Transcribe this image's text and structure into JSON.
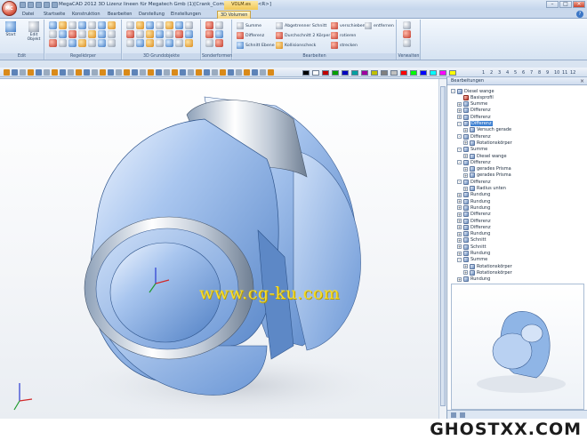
{
  "app": {
    "title": "MegaCAD 2012 3D  Lizenz lineen für Megatech Gmb (1)[Crank_Comsoce-Flan.PRT<R>]",
    "context_tab": "VOLM.es"
  },
  "window_controls": {
    "minimize": "–",
    "maximize": "□",
    "close": "×"
  },
  "tabs": [
    "Datei",
    "Startseite",
    "Konstruktion",
    "Bearbeiten",
    "Darstellung",
    "Einstellungen",
    "3D Volumen"
  ],
  "active_tab": "3D Volumen",
  "ribbon": {
    "groups": {
      "edit": "Edit",
      "regelkoerper": "Regelkörper",
      "grundobjekte": "3D Grundobjekte",
      "sonderformen": "Sonderformen",
      "bearbeiten": "Bearbeiten",
      "verwalten": "Verwalten"
    },
    "start_label": "Start",
    "edit_objekt_label": "Edit Objekt",
    "bool_ops": [
      "Summe",
      "Differenz",
      "Schnitt Ebene"
    ],
    "cut_ops": [
      "Abgetrenner Schnitt",
      "Durchschnitt 2 Körper",
      "Kollisionscheck"
    ],
    "move_ops": [
      "verschieben",
      "rotieren",
      "strecken"
    ],
    "remove_op": "entfernen"
  },
  "toolbar": {
    "colors": [
      "#000000",
      "#ffffff",
      "#c00000",
      "#00a000",
      "#0000c0",
      "#00a0a0",
      "#a000a0",
      "#c0c000",
      "#808080",
      "#c0c0c0",
      "#ff0000",
      "#00ff00",
      "#0000ff",
      "#00ffff",
      "#ff00ff",
      "#ffff00"
    ],
    "layer_numbers": [
      "1",
      "2",
      "3",
      "4",
      "5",
      "6",
      "7",
      "8",
      "9",
      "10",
      "11",
      "12"
    ]
  },
  "viewport": {
    "watermark": "www.cg-ku.com",
    "part_color": "#8fb5e6"
  },
  "panel": {
    "title": "Bearbeitungen",
    "close": "×",
    "tree": [
      {
        "label": "Diesel wange",
        "level": 0,
        "exp": "-",
        "red": false
      },
      {
        "label": "Basisprofil",
        "level": 1,
        "exp": "",
        "red": true
      },
      {
        "label": "Summe",
        "level": 1,
        "exp": "+",
        "red": false
      },
      {
        "label": "Differenz",
        "level": 1,
        "exp": "+",
        "red": false
      },
      {
        "label": "Differenz",
        "level": 1,
        "exp": "+",
        "red": false
      },
      {
        "label": "Differenz",
        "level": 1,
        "exp": "-",
        "red": false,
        "selected": true
      },
      {
        "label": "Versuch gerade",
        "level": 2,
        "exp": "+",
        "red": false
      },
      {
        "label": "Differenz",
        "level": 1,
        "exp": "-",
        "red": false
      },
      {
        "label": "Rotationskörper",
        "level": 2,
        "exp": "+",
        "red": false
      },
      {
        "label": "Summe",
        "level": 1,
        "exp": "-",
        "red": false
      },
      {
        "label": "Diesel wange",
        "level": 2,
        "exp": "+",
        "red": false
      },
      {
        "label": "Differenz",
        "level": 1,
        "exp": "-",
        "red": false
      },
      {
        "label": "gerades Prisma",
        "level": 2,
        "exp": "+",
        "red": false
      },
      {
        "label": "gerades Prisma",
        "level": 2,
        "exp": "+",
        "red": false
      },
      {
        "label": "Differenz",
        "level": 1,
        "exp": "-",
        "red": false
      },
      {
        "label": "Radius unten",
        "level": 2,
        "exp": "+",
        "red": false
      },
      {
        "label": "Rundung",
        "level": 1,
        "exp": "+",
        "red": false
      },
      {
        "label": "Rundung",
        "level": 1,
        "exp": "+",
        "red": false
      },
      {
        "label": "Rundung",
        "level": 1,
        "exp": "+",
        "red": false
      },
      {
        "label": "Differenz",
        "level": 1,
        "exp": "+",
        "red": false
      },
      {
        "label": "Differenz",
        "level": 1,
        "exp": "+",
        "red": false
      },
      {
        "label": "Differenz",
        "level": 1,
        "exp": "+",
        "red": false
      },
      {
        "label": "Rundung",
        "level": 1,
        "exp": "+",
        "red": false
      },
      {
        "label": "Schnitt",
        "level": 1,
        "exp": "+",
        "red": false
      },
      {
        "label": "Schnitt",
        "level": 1,
        "exp": "+",
        "red": false
      },
      {
        "label": "Rundung",
        "level": 1,
        "exp": "+",
        "red": false
      },
      {
        "label": "Summe",
        "level": 1,
        "exp": "-",
        "red": false
      },
      {
        "label": "Rotationskörper",
        "level": 2,
        "exp": "+",
        "red": false
      },
      {
        "label": "Rotationskörper",
        "level": 2,
        "exp": "+",
        "red": false
      },
      {
        "label": "Rundung",
        "level": 1,
        "exp": "+",
        "red": false
      }
    ]
  },
  "brand": "GHOSTXX.COM"
}
